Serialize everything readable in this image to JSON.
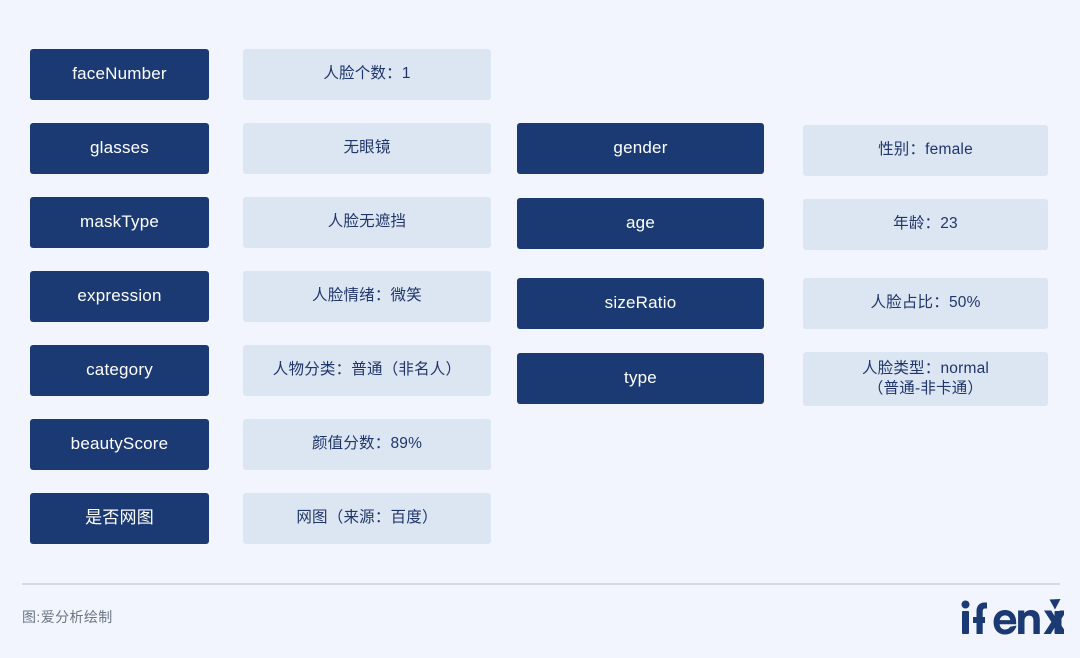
{
  "theme": {
    "background": "#f2f5fd",
    "key_box_color": "#1b3a73",
    "key_text_color": "#ffffff",
    "value_box_color": "#dce6f2",
    "value_text_color": "#20356b",
    "divider_color": "#d5dbe6",
    "credit_text_color": "#6b7585",
    "logo_color": "#1b3a73"
  },
  "left_group": {
    "rows": [
      {
        "key": "faceNumber",
        "value": "人脸个数：1"
      },
      {
        "key": "glasses",
        "value": "无眼镜"
      },
      {
        "key": "maskType",
        "value": "人脸无遮挡"
      },
      {
        "key": "expression",
        "value": "人脸情绪：微笑"
      },
      {
        "key": "category",
        "value": "人物分类：普通（非名人）"
      },
      {
        "key": "beautyScore",
        "value": "颜值分数：89%"
      },
      {
        "key": "是否网图",
        "value": "网图（来源：百度）"
      }
    ]
  },
  "right_group": {
    "rows": [
      {
        "key": "gender",
        "value": "性别：female"
      },
      {
        "key": "age",
        "value": "年龄：23"
      },
      {
        "key": "sizeRatio",
        "value": "人脸占比：50%"
      },
      {
        "key": "type",
        "value": "人脸类型：normal",
        "value_line2": "（普通-非卡通）"
      }
    ]
  },
  "footer": {
    "credit": "图:爱分析绘制",
    "logo_text": "ifenxi"
  }
}
